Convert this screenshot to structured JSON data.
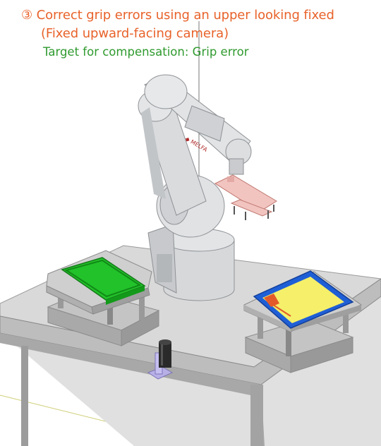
{
  "caption": {
    "title_line1": "③ Correct grip errors using an upper looking fixed",
    "title_line2": "(Fixed upward-facing camera)",
    "subtitle": "Target for compensation: Grip error"
  },
  "colors": {
    "title": "#e8622a",
    "subtitle": "#2e9a2e",
    "robot_body": "#dcdee0",
    "table_top": "#d9d9d9",
    "tray_left": "#22c22a",
    "tray_right_frame": "#1f5fd6",
    "tray_right_fill": "#f5ef6a",
    "gripper": "#f2c4c0",
    "camera_bracket": "#b7b0e6"
  },
  "icons": {
    "robot": "robot-arm-icon",
    "camera": "upward-camera-icon"
  }
}
